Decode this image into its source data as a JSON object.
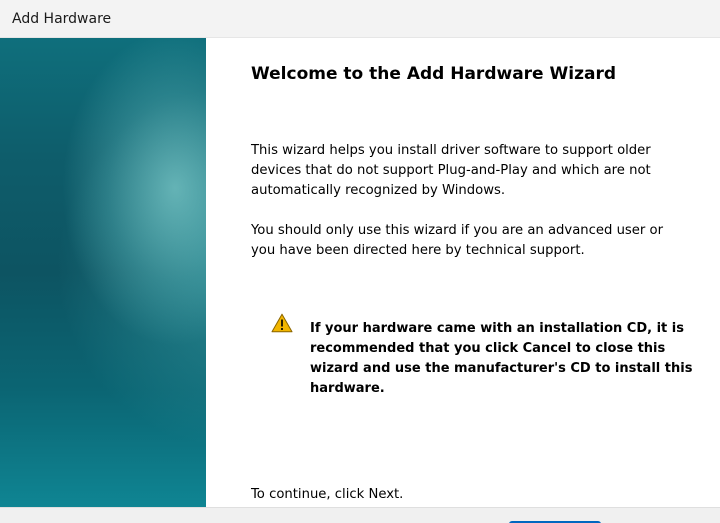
{
  "window": {
    "title": "Add Hardware"
  },
  "wizard": {
    "heading": "Welcome to the Add Hardware Wizard",
    "paragraph_1": "This wizard helps you install driver software to support older devices that do not support Plug-and-Play and which are not automatically recognized by Windows.",
    "paragraph_2": "You should only use this wizard if you are an advanced user or you have been directed here by technical support.",
    "warning": {
      "icon": "warning-icon",
      "text": "If your hardware came with an installation CD, it is recommended that you click Cancel to close this wizard and use the manufacturer's CD to install this hardware."
    },
    "continue_text": "To continue, click Next."
  },
  "colors": {
    "side_panel": "#0e5d6b",
    "title_bar": "#f3f3f3",
    "warning_yellow": "#f2b600",
    "accent_button": "#0067c0"
  }
}
